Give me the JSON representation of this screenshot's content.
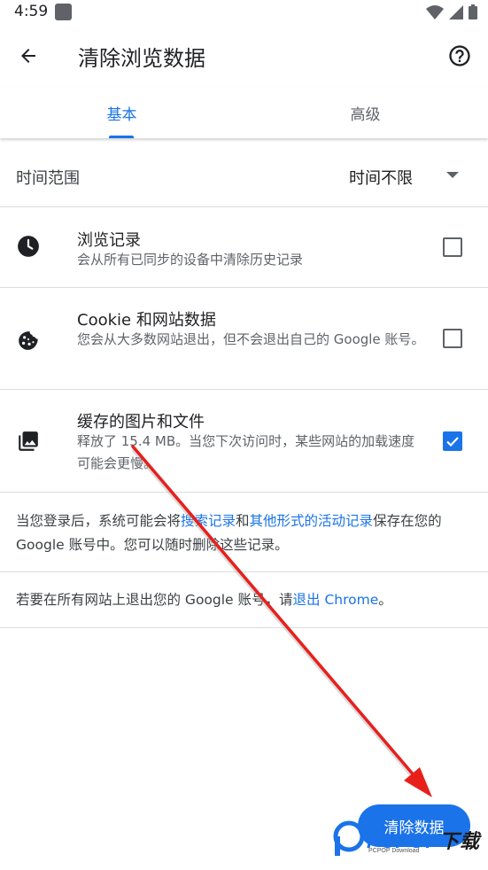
{
  "status_bar": {
    "time": "4:59"
  },
  "app_bar": {
    "title": "清除浏览数据"
  },
  "tabs": [
    {
      "label": "基本",
      "selected": true
    },
    {
      "label": "高级",
      "selected": false
    }
  ],
  "time_range": {
    "label": "时间范围",
    "value": "时间不限"
  },
  "options": [
    {
      "title": "浏览记录",
      "description": "会从所有已同步的设备中清除历史记录",
      "checked": false,
      "icon": "clock-icon"
    },
    {
      "title": "Cookie 和网站数据",
      "description": "您会从大多数网站退出，但不会退出自己的 Google 账号。",
      "checked": false,
      "icon": "cookie-icon"
    },
    {
      "title": "缓存的图片和文件",
      "description": "释放了 15.4 MB。当您下次访问时，某些网站的加载速度可能会更慢。",
      "checked": true,
      "icon": "image-icon"
    }
  ],
  "info1": {
    "prefix": "当您登录后，系统可能会将",
    "link1": "搜索记录",
    "middle": "和",
    "link2": "其他形式的活动记录",
    "suffix": "保存在您的 Google 账号中。您可以随时删除这些记录。"
  },
  "info2": {
    "prefix": "若要在所有网站上退出您的 Google 账号，请",
    "link": "退出 Chrome",
    "suffix": "。"
  },
  "clear_button": {
    "label": "清除数据"
  },
  "watermark": {
    "text_main": "PCPOP",
    "text_dl": "下载",
    "text_sub": "PCPOP Download"
  },
  "colors": {
    "accent": "#1a73e8",
    "annotation_arrow": "#e8201c"
  }
}
